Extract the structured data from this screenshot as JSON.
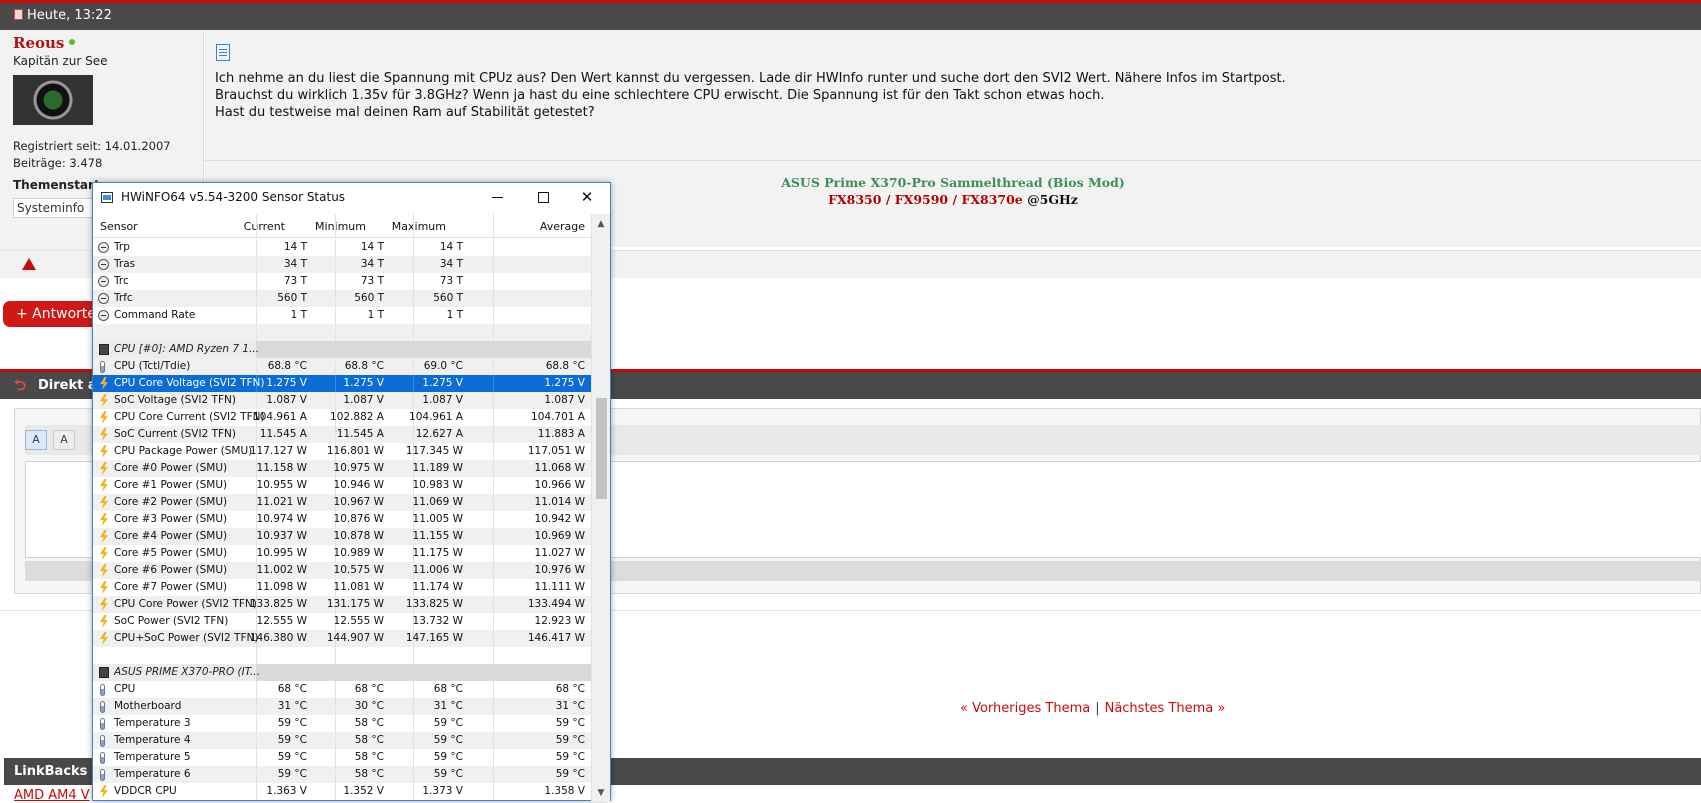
{
  "post": {
    "timestamp": "Heute, 13:22",
    "user": {
      "name": "Reous",
      "title": "Kapitän zur See",
      "registered": "Registriert seit: 14.01.2007",
      "posts": "Beiträge: 3.478",
      "starter_label": "Themenstarter",
      "sysinfo_button": "Systeminfo"
    },
    "lines": [
      "Ich nehme an du liest die Spannung mit CPUz aus? Den Wert kannst du vergessen. Lade dir HWInfo runter und suche dort den SVI2 Wert. Nähere Infos im Startpost.",
      "Brauchst du wirklich 1.35v für 3.8GHz? Wenn ja hast du eine schlechtere CPU erwischt. Die Spannung ist für den Takt schon etwas hoch.",
      "Hast du testweise mal deinen Ram auf Stabilität getestet?"
    ],
    "signature": {
      "line1": "ASUS Prime X370-Pro Sammelthread (Bios Mod)",
      "link_a": "FX8350",
      "link_b": "FX9590",
      "link_c": "FX8370e",
      "slash": "/",
      "suffix": "@5GHz"
    }
  },
  "reply_button": "+ Antworten",
  "quick_reply": {
    "title": "Direkt a",
    "arrow": "⮌",
    "toolbar_a": "A",
    "toolbar_b": "A"
  },
  "nav": {
    "prev": "« Vorheriges Thema",
    "sep": "|",
    "next": "Nächstes Thema »"
  },
  "linkbacks": {
    "title": "LinkBacks (",
    "first_link": "AMD AM4 V"
  },
  "hwinfo": {
    "title": "HWiNFO64 v5.54-3200 Sensor Status",
    "window_controls": {
      "minimize": "minimize",
      "maximize": "maximize",
      "close": "✕"
    },
    "columns": {
      "sensor": "Sensor",
      "current": "Current",
      "minimum": "Minimum",
      "maximum": "Maximum",
      "average": "Average"
    },
    "rows": [
      {
        "type": "clock",
        "name": "Trp",
        "cur": "14 T",
        "min": "14 T",
        "max": "14 T",
        "avg": ""
      },
      {
        "type": "clock",
        "name": "Tras",
        "cur": "34 T",
        "min": "34 T",
        "max": "34 T",
        "avg": ""
      },
      {
        "type": "clock",
        "name": "Trc",
        "cur": "73 T",
        "min": "73 T",
        "max": "73 T",
        "avg": ""
      },
      {
        "type": "clock",
        "name": "Trfc",
        "cur": "560 T",
        "min": "560 T",
        "max": "560 T",
        "avg": ""
      },
      {
        "type": "clock",
        "name": "Command Rate",
        "cur": "1 T",
        "min": "1 T",
        "max": "1 T",
        "avg": ""
      },
      {
        "type": "blank",
        "name": "",
        "cur": "",
        "min": "",
        "max": "",
        "avg": ""
      },
      {
        "type": "group",
        "name": "CPU [#0]: AMD Ryzen 7 1...",
        "cur": "",
        "min": "",
        "max": "",
        "avg": ""
      },
      {
        "type": "therm",
        "name": "CPU (Tctl/Tdie)",
        "cur": "68.8 °C",
        "min": "68.8 °C",
        "max": "69.0 °C",
        "avg": "68.8 °C"
      },
      {
        "type": "bolt",
        "name": "CPU Core Voltage (SVI2 TFN)",
        "cur": "1.275 V",
        "min": "1.275 V",
        "max": "1.275 V",
        "avg": "1.275 V",
        "selected": true
      },
      {
        "type": "bolt",
        "name": "SoC Voltage (SVI2 TFN)",
        "cur": "1.087 V",
        "min": "1.087 V",
        "max": "1.087 V",
        "avg": "1.087 V"
      },
      {
        "type": "bolt",
        "name": "CPU Core Current (SVI2 TFN)",
        "cur": "104.961 A",
        "min": "102.882 A",
        "max": "104.961 A",
        "avg": "104.701 A"
      },
      {
        "type": "bolt",
        "name": "SoC Current (SVI2 TFN)",
        "cur": "11.545 A",
        "min": "11.545 A",
        "max": "12.627 A",
        "avg": "11.883 A"
      },
      {
        "type": "bolt",
        "name": "CPU Package Power (SMU)",
        "cur": "117.127 W",
        "min": "116.801 W",
        "max": "117.345 W",
        "avg": "117.051 W"
      },
      {
        "type": "bolt",
        "name": "Core #0 Power (SMU)",
        "cur": "11.158 W",
        "min": "10.975 W",
        "max": "11.189 W",
        "avg": "11.068 W"
      },
      {
        "type": "bolt",
        "name": "Core #1 Power (SMU)",
        "cur": "10.955 W",
        "min": "10.946 W",
        "max": "10.983 W",
        "avg": "10.966 W"
      },
      {
        "type": "bolt",
        "name": "Core #2 Power (SMU)",
        "cur": "11.021 W",
        "min": "10.967 W",
        "max": "11.069 W",
        "avg": "11.014 W"
      },
      {
        "type": "bolt",
        "name": "Core #3 Power (SMU)",
        "cur": "10.974 W",
        "min": "10.876 W",
        "max": "11.005 W",
        "avg": "10.942 W"
      },
      {
        "type": "bolt",
        "name": "Core #4 Power (SMU)",
        "cur": "10.937 W",
        "min": "10.878 W",
        "max": "11.155 W",
        "avg": "10.969 W"
      },
      {
        "type": "bolt",
        "name": "Core #5 Power (SMU)",
        "cur": "10.995 W",
        "min": "10.989 W",
        "max": "11.175 W",
        "avg": "11.027 W"
      },
      {
        "type": "bolt",
        "name": "Core #6 Power (SMU)",
        "cur": "11.002 W",
        "min": "10.575 W",
        "max": "11.006 W",
        "avg": "10.976 W"
      },
      {
        "type": "bolt",
        "name": "Core #7 Power (SMU)",
        "cur": "11.098 W",
        "min": "11.081 W",
        "max": "11.174 W",
        "avg": "11.111 W"
      },
      {
        "type": "bolt",
        "name": "CPU Core Power (SVI2 TFN)",
        "cur": "133.825 W",
        "min": "131.175 W",
        "max": "133.825 W",
        "avg": "133.494 W"
      },
      {
        "type": "bolt",
        "name": "SoC Power (SVI2 TFN)",
        "cur": "12.555 W",
        "min": "12.555 W",
        "max": "13.732 W",
        "avg": "12.923 W"
      },
      {
        "type": "bolt",
        "name": "CPU+SoC Power (SVI2 TFN)",
        "cur": "146.380 W",
        "min": "144.907 W",
        "max": "147.165 W",
        "avg": "146.417 W"
      },
      {
        "type": "blank",
        "name": "",
        "cur": "",
        "min": "",
        "max": "",
        "avg": ""
      },
      {
        "type": "group",
        "name": "ASUS PRIME X370-PRO (IT...",
        "cur": "",
        "min": "",
        "max": "",
        "avg": ""
      },
      {
        "type": "therm",
        "name": "CPU",
        "cur": "68 °C",
        "min": "68 °C",
        "max": "68 °C",
        "avg": "68 °C"
      },
      {
        "type": "therm",
        "name": "Motherboard",
        "cur": "31 °C",
        "min": "30 °C",
        "max": "31 °C",
        "avg": "31 °C"
      },
      {
        "type": "therm",
        "name": "Temperature 3",
        "cur": "59 °C",
        "min": "58 °C",
        "max": "59 °C",
        "avg": "59 °C"
      },
      {
        "type": "therm",
        "name": "Temperature 4",
        "cur": "59 °C",
        "min": "58 °C",
        "max": "59 °C",
        "avg": "59 °C"
      },
      {
        "type": "therm",
        "name": "Temperature 5",
        "cur": "59 °C",
        "min": "58 °C",
        "max": "59 °C",
        "avg": "59 °C"
      },
      {
        "type": "therm",
        "name": "Temperature 6",
        "cur": "59 °C",
        "min": "58 °C",
        "max": "59 °C",
        "avg": "59 °C"
      },
      {
        "type": "bolt",
        "name": "VDDCR CPU",
        "cur": "1.363 V",
        "min": "1.352 V",
        "max": "1.373 V",
        "avg": "1.358 V"
      }
    ],
    "scroll": {
      "up": "▲",
      "down": "▼"
    }
  },
  "colors": {
    "accent": "#c90a0a",
    "header_bg": "#494949",
    "selection": "#0a6cd6",
    "signature_green": "#3b8f5a"
  }
}
